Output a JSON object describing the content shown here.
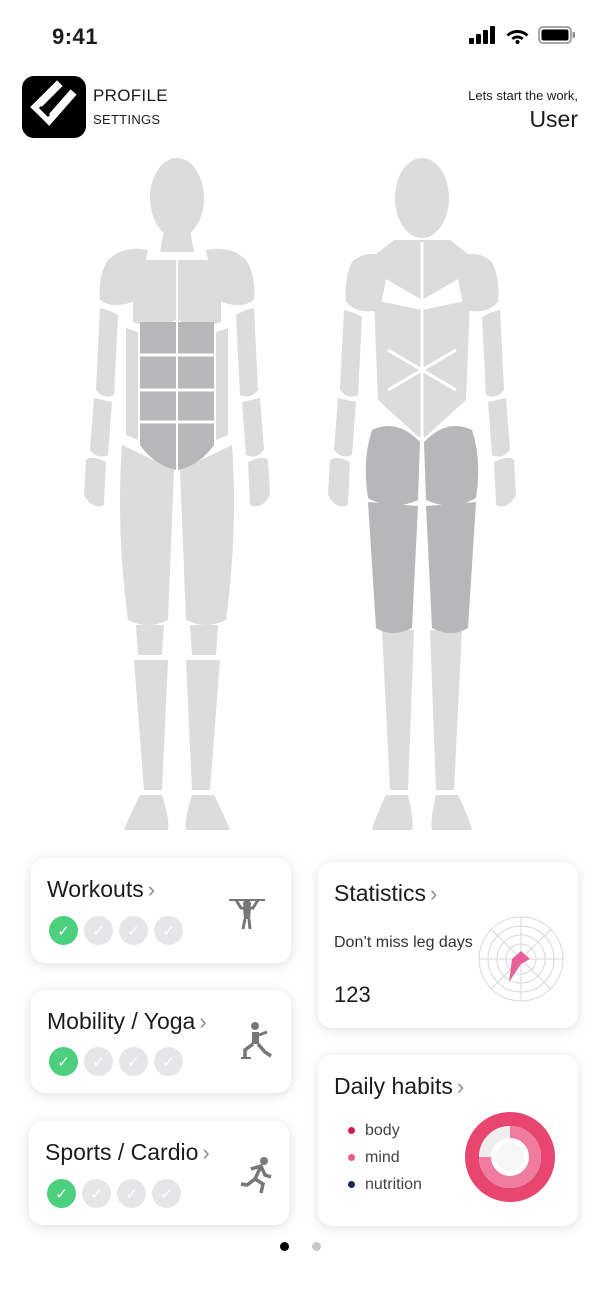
{
  "status": {
    "time": "9:41"
  },
  "header": {
    "profile_title": "PROFILE",
    "profile_subtitle": "SETTINGS",
    "greeting": "Lets start the work,",
    "username": "User"
  },
  "cards": {
    "workouts": {
      "title": "Workouts",
      "chevron": "›",
      "completed": 1,
      "total": 4,
      "icon": "pullup-icon"
    },
    "mobility": {
      "title": "Mobility / Yoga",
      "chevron": "›",
      "completed": 1,
      "total": 4,
      "icon": "lunge-icon"
    },
    "sports": {
      "title": "Sports / Cardio",
      "chevron": "›",
      "completed": 1,
      "total": 4,
      "icon": "running-icon"
    },
    "statistics": {
      "title": "Statistics",
      "chevron": "›",
      "text": "Don’t miss leg days",
      "value": "123"
    },
    "habits": {
      "title": "Daily habits",
      "chevron": "›",
      "legend": [
        {
          "label": "body",
          "color": "#d81b4f"
        },
        {
          "label": "mind",
          "color": "#ef5a8c"
        },
        {
          "label": "nutrition",
          "color": "#1a2a4a"
        }
      ]
    }
  },
  "pager": {
    "pages": 2,
    "active": 0
  },
  "colors": {
    "muscle_light": "#dcdcdc",
    "muscle_highlight": "#b7b7b9",
    "check_done": "#4cd07e",
    "check_todo": "#e6e6e8",
    "ring_outer": "#e8466f",
    "ring_inner": "#f07ba0"
  }
}
